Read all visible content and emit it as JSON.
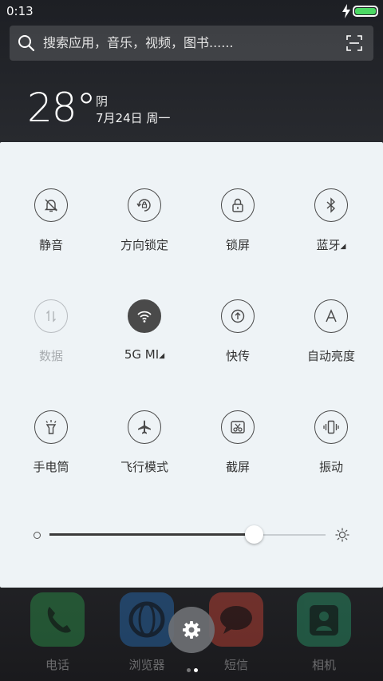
{
  "status_bar": {
    "time": "0:13",
    "battery_level": 1.0
  },
  "search": {
    "placeholder": "搜索应用，音乐，视频，图书......"
  },
  "weather": {
    "temperature": "28°",
    "condition": "阴",
    "date": "7月24日 周一"
  },
  "quick_settings": {
    "row1": [
      {
        "label": "静音",
        "icon": "bell-off-icon",
        "state": "off"
      },
      {
        "label": "方向锁定",
        "icon": "rotation-lock-icon",
        "state": "off"
      },
      {
        "label": "锁屏",
        "icon": "lock-icon",
        "state": "off"
      },
      {
        "label": "蓝牙",
        "icon": "bluetooth-icon",
        "state": "off",
        "expandable": true
      }
    ],
    "row2": [
      {
        "label": "数据",
        "icon": "mobile-data-icon",
        "state": "disabled"
      },
      {
        "label": "5G MI",
        "icon": "wifi-icon",
        "state": "on",
        "expandable": true
      },
      {
        "label": "快传",
        "icon": "quick-share-icon",
        "state": "off"
      },
      {
        "label": "自动亮度",
        "icon": "auto-brightness-icon",
        "state": "off"
      }
    ],
    "row3": [
      {
        "label": "手电筒",
        "icon": "flashlight-icon",
        "state": "off"
      },
      {
        "label": "飞行模式",
        "icon": "airplane-icon",
        "state": "off"
      },
      {
        "label": "截屏",
        "icon": "screenshot-icon",
        "state": "off"
      },
      {
        "label": "振动",
        "icon": "vibrate-icon",
        "state": "off"
      }
    ]
  },
  "brightness": {
    "level": 0.74
  },
  "dock": {
    "apps": [
      {
        "label": "电话",
        "icon": "phone-icon",
        "color": "#2fae53"
      },
      {
        "label": "浏览器",
        "icon": "browser-icon",
        "color": "#2a7fd6"
      },
      {
        "label": "短信",
        "icon": "message-icon",
        "color": "#f04b3a"
      },
      {
        "label": "相机",
        "icon": "camera-icon",
        "color": "#2bb37a"
      }
    ]
  },
  "colors": {
    "panel_bg": "#eef3f6",
    "icon_dark": "#4a4a4a",
    "battery": "#4cd964"
  }
}
